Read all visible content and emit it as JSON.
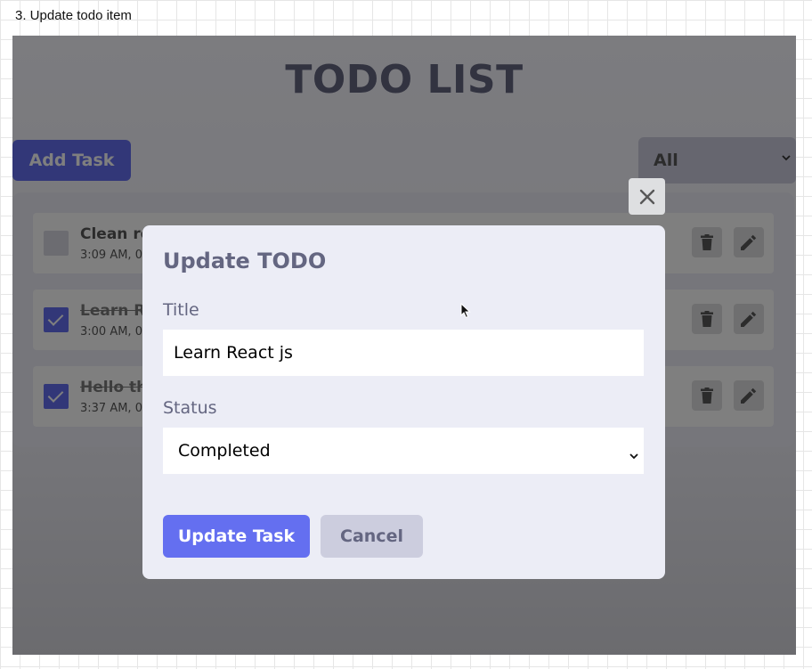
{
  "caption": "3. Update todo item",
  "app": {
    "title": "TODO LIST",
    "add_button": "Add Task",
    "filter": {
      "selected": "All"
    }
  },
  "todos": [
    {
      "title": "Clean ro",
      "time": "3:09 AM, 0",
      "completed": false
    },
    {
      "title": "Learn Re",
      "time": "3:00 AM, 0",
      "completed": true
    },
    {
      "title": "Hello the",
      "time": "3:37 AM, 0",
      "completed": true
    }
  ],
  "modal": {
    "heading": "Update TODO",
    "title_label": "Title",
    "title_value": "Learn React js",
    "status_label": "Status",
    "status_value": "Completed",
    "update_button": "Update Task",
    "cancel_button": "Cancel"
  },
  "icons": {
    "close": "close-icon",
    "delete": "trash-icon",
    "edit": "pencil-icon",
    "dropdown": "chevron-down-icon",
    "cursor": "mouse-pointer-icon"
  },
  "colors": {
    "accent": "#646ff0",
    "muted_button": "#cccdde",
    "heading": "#646681",
    "overlay": "rgba(0,0,0,0.5)"
  }
}
